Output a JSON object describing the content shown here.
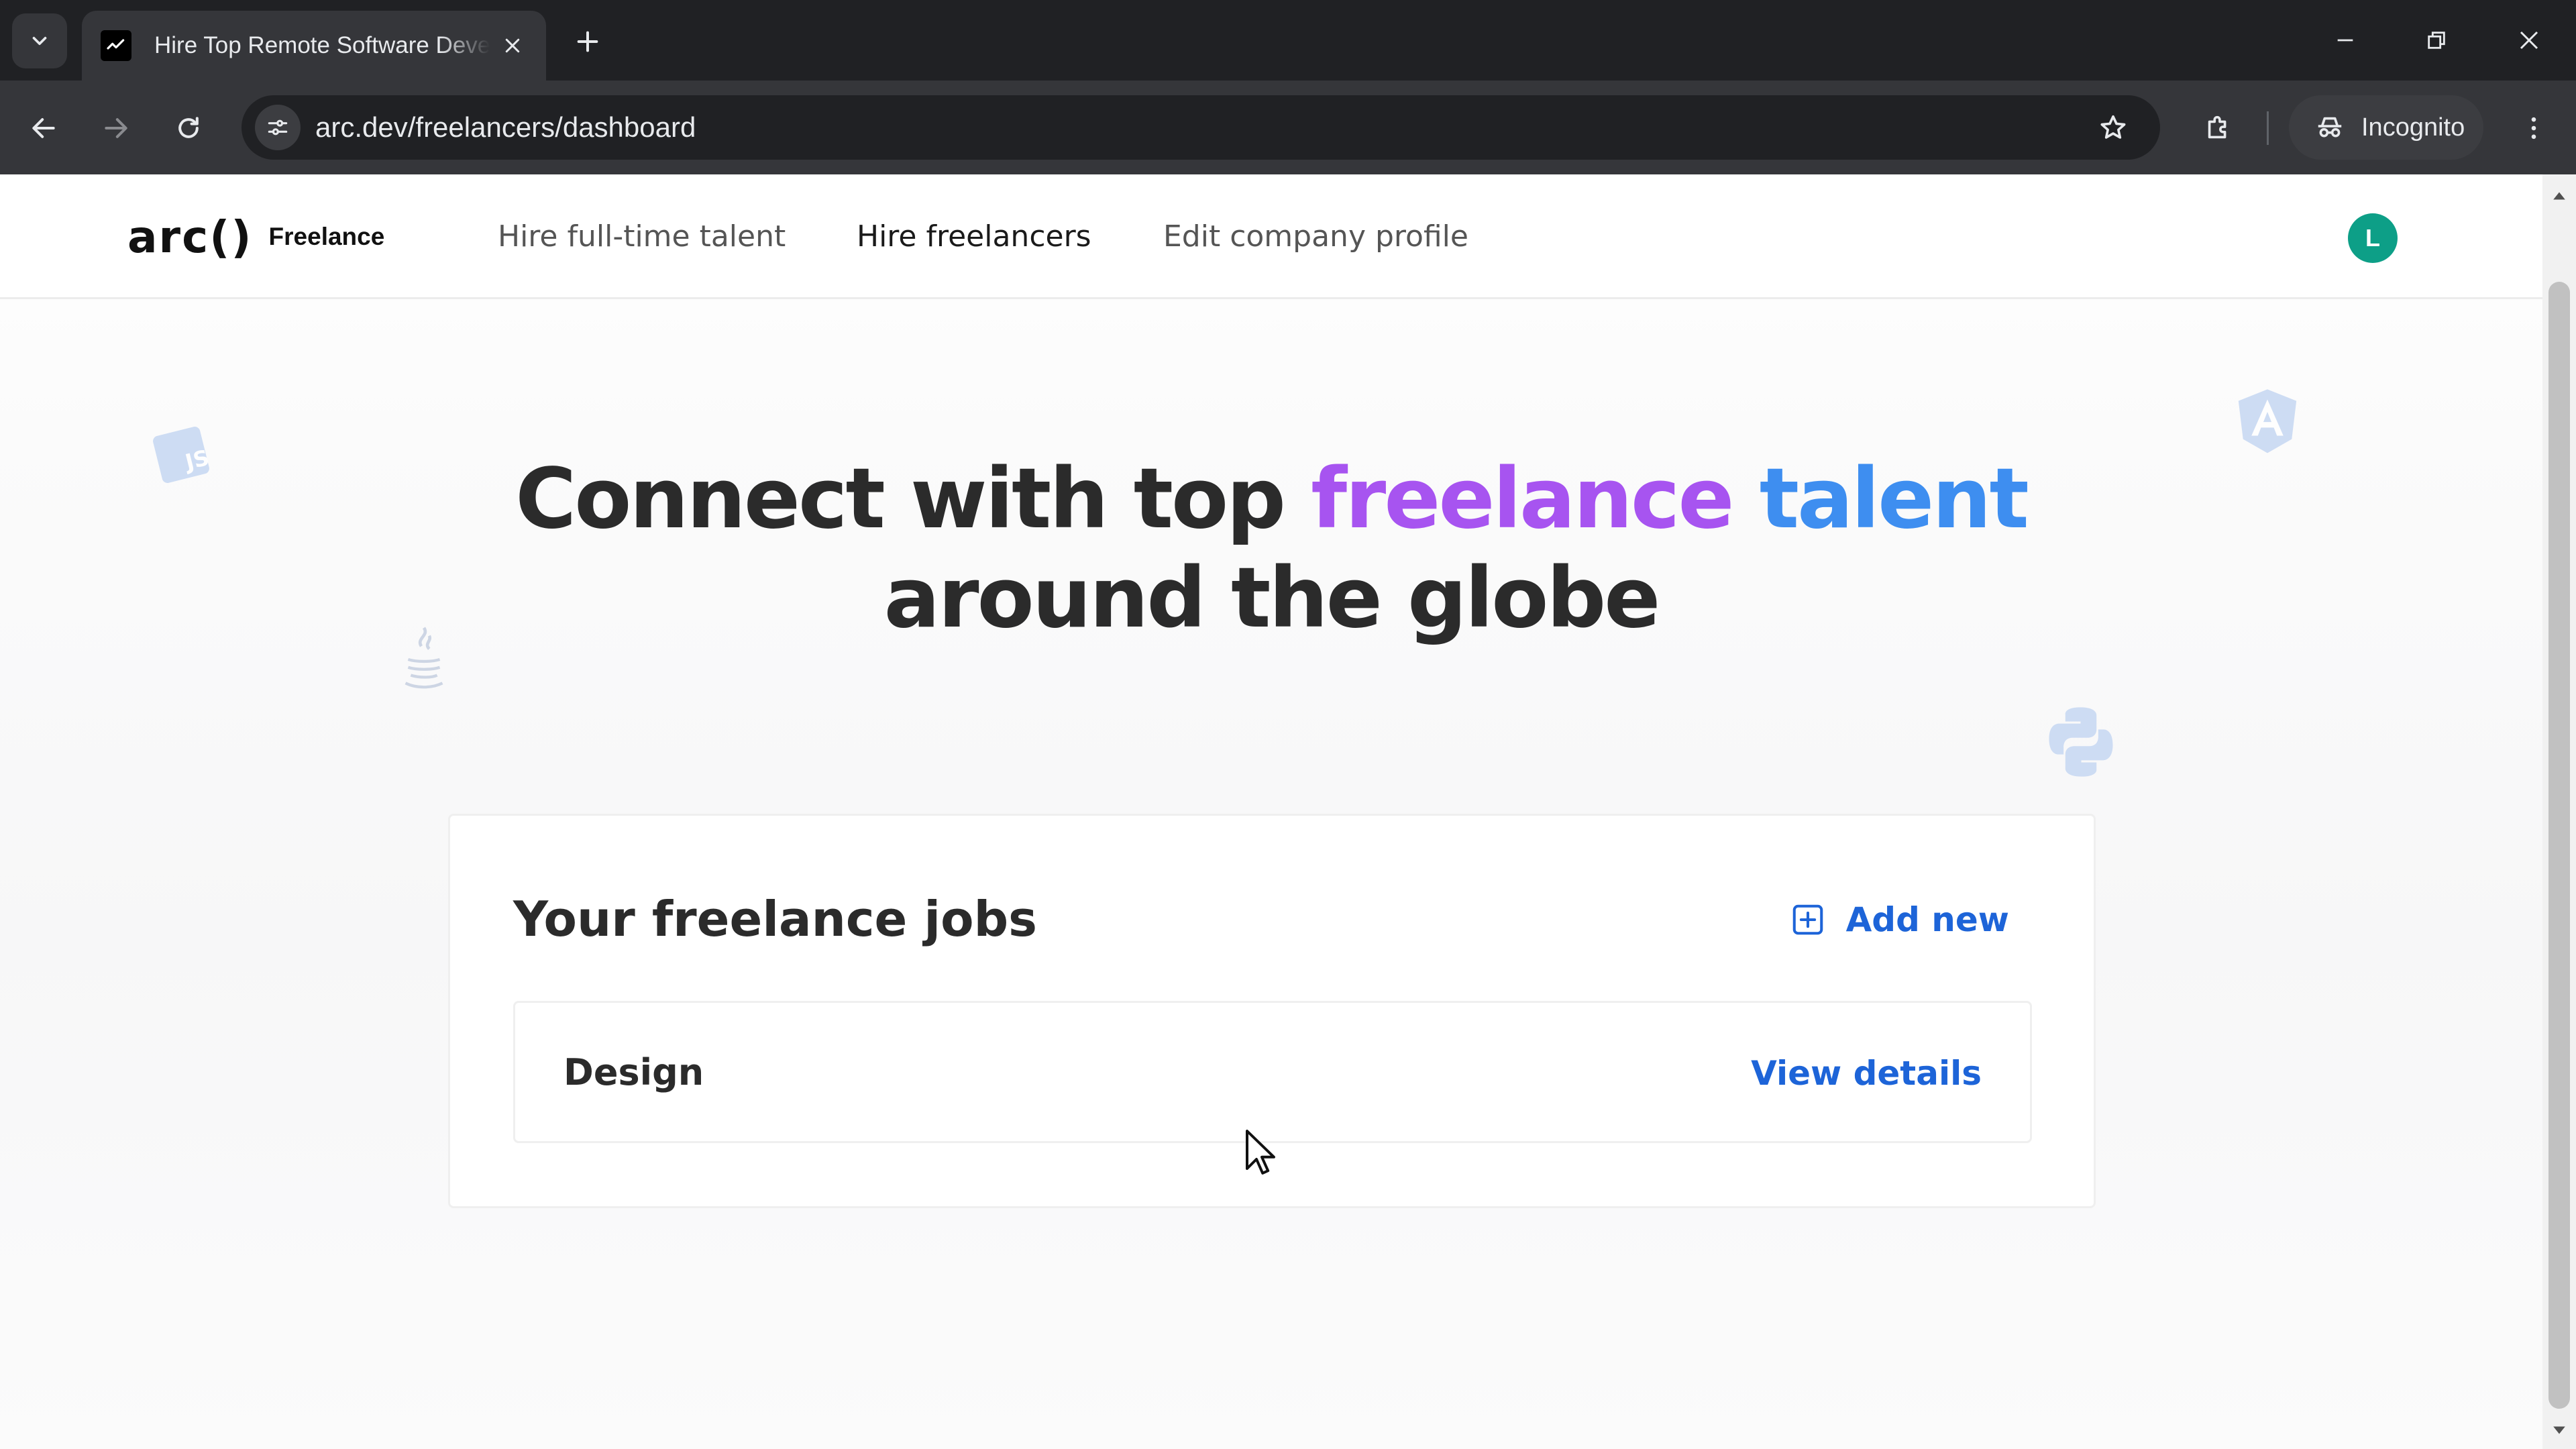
{
  "browser": {
    "tab_title": "Hire Top Remote Software Developers",
    "url": "arc.dev/freelancers/dashboard",
    "profile_label": "Incognito",
    "icons": {
      "tab_search": "chevron-down-icon",
      "favicon": "arc-favicon",
      "tab_close": "close-icon",
      "new_tab": "plus-icon",
      "back": "arrow-left-icon",
      "forward": "arrow-right-icon",
      "reload": "reload-icon",
      "site_info": "tune-icon",
      "bookmark": "star-icon",
      "extensions": "puzzle-icon",
      "incognito": "incognito-icon",
      "menu": "kebab-menu-icon"
    }
  },
  "site": {
    "logo": "arc()",
    "logo_sub": "Freelance",
    "nav": [
      {
        "label": "Hire full-time talent",
        "active": false
      },
      {
        "label": "Hire freelancers",
        "active": true
      },
      {
        "label": "Edit company profile",
        "active": false
      }
    ],
    "avatar_initial": "L",
    "avatar_color": "#0d9f87"
  },
  "hero": {
    "line1_prefix": "Connect with top ",
    "highlight_1": "freelance",
    "highlight_space": " ",
    "highlight_2": "talent",
    "line2": "around the globe",
    "highlight_colors": [
      "#a754f0",
      "#3e8ef0"
    ]
  },
  "decorations": [
    "js-icon",
    "java-icon",
    "angular-icon",
    "python-icon"
  ],
  "jobs": {
    "title": "Your freelance jobs",
    "add_label": "Add new",
    "items": [
      {
        "name": "Design",
        "action": "View details"
      }
    ],
    "link_color": "#1d64d8"
  }
}
